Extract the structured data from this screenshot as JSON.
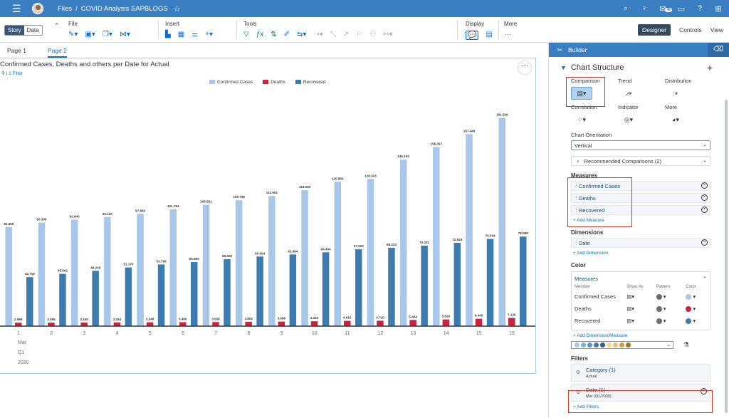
{
  "shell": {
    "breadcrumb_root": "Files",
    "breadcrumb_sep": "/",
    "story_title": "COVID Analysis SAPBLOGS",
    "notification_count": "46"
  },
  "toolbar": {
    "story_label": "Story",
    "data_label": "Data",
    "file_label": "File",
    "insert_label": "Insert",
    "tools_label": "Tools",
    "display_label": "Display",
    "more_label": "More",
    "designer_label": "Designer",
    "controls_label": "Controls",
    "view_label": "View"
  },
  "pages": [
    {
      "label": "Page 1"
    },
    {
      "label": "Page 2"
    }
  ],
  "chart": {
    "title": "Confirmed Cases, Deaths and others per Date for Actual",
    "filter_link": "| 1 Filter"
  },
  "chart_data": {
    "type": "bar",
    "categories": [
      "1",
      "2",
      "3",
      "4",
      "5",
      "6",
      "7",
      "8",
      "9",
      "10",
      "11",
      "12",
      "13",
      "14",
      "15",
      "16"
    ],
    "axis_sub_labels": [
      "Mar",
      "Q1",
      "2020"
    ],
    "series": [
      {
        "name": "Confirmed Cases",
        "color": "#a9c7e8",
        "values": [
          86369,
          90306,
          92840,
          95120,
          97882,
          101784,
          105821,
          109795,
          113561,
          118592,
          125865,
          128343,
          145193,
          156097,
          167449,
          181546
        ],
        "labels": [
          "86.369",
          "90.306",
          "92.840",
          "95.120",
          "97.882",
          "101.784",
          "105.821",
          "109.795",
          "113.561",
          "118.592",
          "125.865",
          "128.343",
          "145.193",
          "156.097",
          "167.449",
          "181.546"
        ]
      },
      {
        "name": "Deaths",
        "color": "#c8243e",
        "values": [
          2996,
          3085,
          3160,
          3254,
          3348,
          3460,
          3558,
          3802,
          3988,
          4262,
          4615,
          4720,
          5404,
          5819,
          6440,
          7126
        ],
        "labels": [
          "2.996",
          "3.085",
          "3.160",
          "3.254",
          "3.348",
          "3.460",
          "3.558",
          "3.802",
          "3.988",
          "4.262",
          "4.615",
          "4.720",
          "5.404",
          "5.819",
          "6.440",
          "7.126"
        ]
      },
      {
        "name": "Recovered",
        "color": "#3e7cb0",
        "values": [
          42716,
          45602,
          48228,
          51170,
          53796,
          55865,
          58358,
          60694,
          62494,
          64404,
          67003,
          68324,
          70251,
          72624,
          76034,
          78088
        ],
        "labels": [
          "42.716",
          "45.602",
          "48.228",
          "51.170",
          "53.796",
          "55.865",
          "58.358",
          "60.694",
          "62.494",
          "64.404",
          "67.003",
          "68.324",
          "70.251",
          "72.624",
          "76.034",
          "78.088"
        ]
      }
    ],
    "ylim": [
      0,
      190000
    ],
    "legend_position": "top-center",
    "grid": false
  },
  "builder": {
    "title": "Builder",
    "section_title": "Chart Structure",
    "types": [
      {
        "label": "Comparison",
        "icon": "bar-chart-icon"
      },
      {
        "label": "Trend",
        "icon": "line-chart-icon"
      },
      {
        "label": "Distribution",
        "icon": "distribution-icon"
      },
      {
        "label": "Correlation",
        "icon": "scatter-icon"
      },
      {
        "label": "Indicator",
        "icon": "gauge-icon"
      },
      {
        "label": "More",
        "icon": "pie-icon"
      }
    ],
    "orientation_label": "Chart Orientation",
    "orientation_value": "Vertical",
    "recommended": "Recommended Comparisons (2)",
    "measures_title": "Measures",
    "measures": [
      "Confirmed Cases",
      "Deaths",
      "Recovered"
    ],
    "add_measure": "+ Add Measure",
    "dimensions_title": "Dimensions",
    "dimensions": [
      "Date"
    ],
    "add_dimension": "+ Add Dimension",
    "color_title": "Color",
    "color_measures_label": "Measures",
    "color_headers": [
      "Member",
      "Show As",
      "Pattern",
      "Color"
    ],
    "color_rows": [
      {
        "name": "Confirmed Cases",
        "color": "#a9c7e8"
      },
      {
        "name": "Deaths",
        "color": "#c8243e"
      },
      {
        "name": "Recovered",
        "color": "#3e7cb0"
      }
    ],
    "add_dim_measure": "+ Add Dimension/Measure",
    "palette": [
      "#a9c7e8",
      "#7fb0dc",
      "#5a93c8",
      "#3e7cb0",
      "#2a5f8f",
      "#f5d98c",
      "#e8c46a",
      "#c9a23a",
      "#9a7a22"
    ],
    "filters_title": "Filters",
    "filters": [
      {
        "title": "Category (1)",
        "sub": "Actual"
      },
      {
        "title": "Date (1)",
        "sub": "Mar (Q1/2020)"
      }
    ],
    "add_filters": "+ Add Filters"
  }
}
